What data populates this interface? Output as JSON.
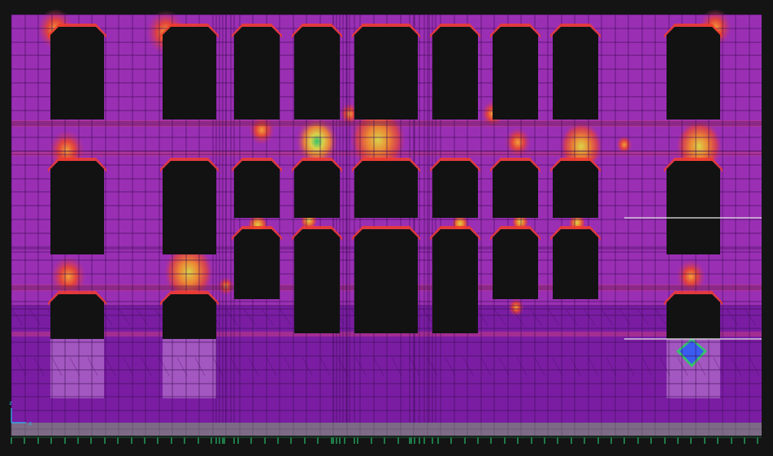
{
  "viewport": {
    "background": "#141414",
    "colors": {
      "wall_base": "#9a2fb4",
      "wall_lower": "#7a1da3",
      "opening_fill": "#121212",
      "mesh_line": "#3a0b52",
      "slab_band": "#c23a86",
      "hot_red": "#ef3b2c",
      "hot_orange": "#f08a2c",
      "hot_yellow": "#d9d24a",
      "hot_green": "#35c46c",
      "cold_blue": "#3a5cf0",
      "foundation": "#7c6a86",
      "support_tick": "#27e07a",
      "selection_line": "#e8e8e8",
      "pier_lower": "#b26bc9"
    },
    "axis": {
      "z_label": "z",
      "x_label": "x",
      "color": "#29b6f6"
    }
  }
}
